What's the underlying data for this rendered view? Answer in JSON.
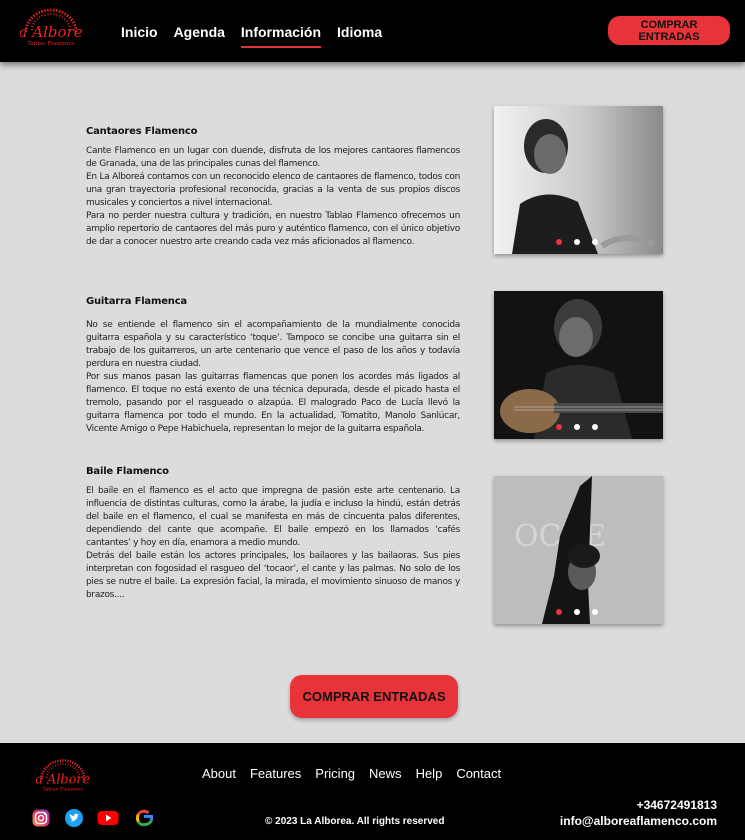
{
  "header": {
    "logo": {
      "name": "La AlboreA",
      "subtitle": "Tablao Flamenco"
    },
    "nav": [
      {
        "label": "Inicio",
        "active": false
      },
      {
        "label": "Agenda",
        "active": false
      },
      {
        "label": "Información",
        "active": true
      },
      {
        "label": "Idioma",
        "active": false
      }
    ],
    "cta_label": "COMPRAR ENTRADAS"
  },
  "sections": [
    {
      "title": "Cantaores Flamenco",
      "paragraphs": [
        "Cante Flamenco en un lugar con duende, disfruta de los mejores cantaores flamencos de Granada, una de las principales cunas del flamenco.",
        "En La Alboreá contamos con un reconocido elenco de cantaores de flamenco, todos con una gran trayectoria profesional reconocida, gracias a la venta de sus propios discos musicales y conciertos a nivel internacional.",
        "Para no perder nuestra cultura y tradición, en nuestro Tablao Flamenco ofrecemos un amplio repertorio de cantaores del más puro y auténtico flamenco, con el único objetivo de dar a conocer nuestro arte creando cada vez más aficionados al flamenco."
      ],
      "carousel_active": 0
    },
    {
      "title": "Guitarra Flamenca",
      "paragraphs": [
        "No se entiende el flamenco sin el acompañamiento de la mundialmente conocida guitarra española y su característico ‘toque’. Tampoco se concibe una guitarra sin el trabajo de los guitarreros, un arte centenario que vence el paso de los años y todavía perdura en nuestra ciudad.",
        "Por sus manos pasan las guitarras flamencas que ponen los acordes más ligados al flamenco. El toque no está exento de una técnica depurada, desde el picado hasta el tremolo, pasando por el rasgueado o alzapúa. El malogrado Paco de Lucía llevó la guitarra flamenca por todo el mundo. En la actualidad, Tomatito, Manolo Sanlúcar, Vicente Amigo o Pepe Habichuela, representan lo mejor de la guitarra española."
      ],
      "carousel_active": 0
    },
    {
      "title": "Baile Flamenco",
      "paragraphs": [
        "El baile en el flamenco es el acto que impregna de pasión este arte centenario. La influencia de distintas culturas, como la árabe, la judía e incluso la hindú, están detrás del baile en el flamenco, el cual se manifesta en más de cincuenta palos diferentes, dependiendo del cante que acompañe. El baile empezó en los llamados ‘cafés cantantes’ y hoy en día, enamora a medio mundo.",
        "Detrás del baile están los actores principales, los bailaores y las bailaoras. Sus pies interpretan con fogosidad el rasgueo del ‘tocaor’, el cante y las palmas. No solo de los pies se nutre el baile. La expresión facial, la mirada, el movimiento sinuoso de manos y brazos...."
      ],
      "carousel_active": 0
    }
  ],
  "main_cta_label": "COMPRAR ENTRADAS",
  "footer": {
    "links": [
      "About",
      "Features",
      "Pricing",
      "News",
      "Help",
      "Contact"
    ],
    "copyright": "© 2023 La Alborea. All rights reserved",
    "phone": "+34672491813",
    "email": "info@alboreaflamenco.com",
    "social_icons": [
      "instagram-icon",
      "twitter-icon",
      "youtube-icon",
      "google-icon"
    ]
  },
  "colors": {
    "accent": "#e8333b",
    "header_bg": "#000000",
    "page_bg": "#dcdcdc"
  }
}
